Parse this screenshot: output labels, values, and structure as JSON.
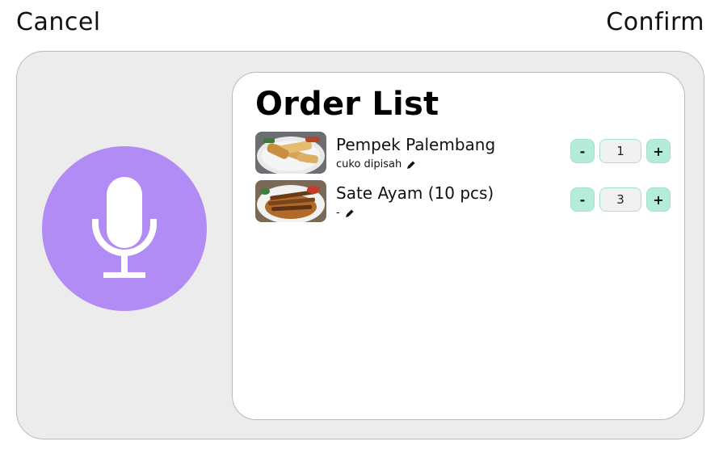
{
  "header": {
    "cancel_label": "Cancel",
    "confirm_label": "Confirm"
  },
  "voice": {
    "icon": "microphone-icon",
    "color": "#b28cf5"
  },
  "order": {
    "title": "Order List",
    "items": [
      {
        "name": "Pempek Palembang",
        "note": "cuko dipisah",
        "quantity": "1",
        "thumbnail": "pempek-image",
        "decrement_label": "-",
        "increment_label": "+"
      },
      {
        "name": "Sate Ayam (10 pcs)",
        "note": "-",
        "quantity": "3",
        "thumbnail": "sate-image",
        "decrement_label": "-",
        "increment_label": "+"
      }
    ]
  },
  "colors": {
    "accent": "#b28cf5",
    "stepper": "#b5ecd7",
    "panel": "#ececec"
  }
}
